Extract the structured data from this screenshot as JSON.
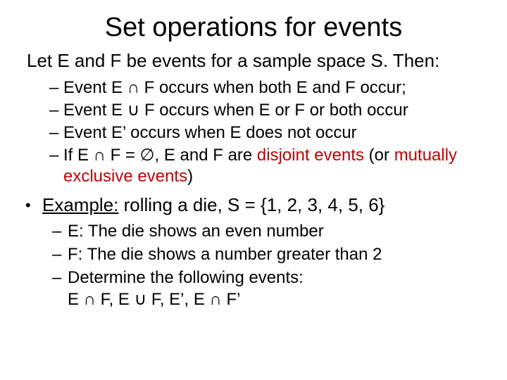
{
  "title": "Set operations for events",
  "intro": "Let E and F be events for a sample space S. Then:",
  "bullets": {
    "b1": "Event E ∩ F occurs when both E and F occur;",
    "b2": "Event E ∪ F occurs when E or F or both occur",
    "b3": "Event E’ occurs when E does not occur",
    "b4_prefix": " If E ∩ F = ∅, E and F are ",
    "b4_red1": "disjoint events",
    "b4_mid": " (or ",
    "b4_red2": "mutually exclusive events",
    "b4_suffix": ")"
  },
  "example": {
    "label": "Example:",
    "rest": " rolling a die, S = {1, 2, 3, 4, 5, 6}"
  },
  "sub": {
    "s1": " E: The die shows an even number",
    "s2": " F: The die shows a number greater than 2",
    "s3a": " Determine the following events:",
    "s3b": "E ∩ F, E ∪ F, E’, E ∩ F’"
  }
}
